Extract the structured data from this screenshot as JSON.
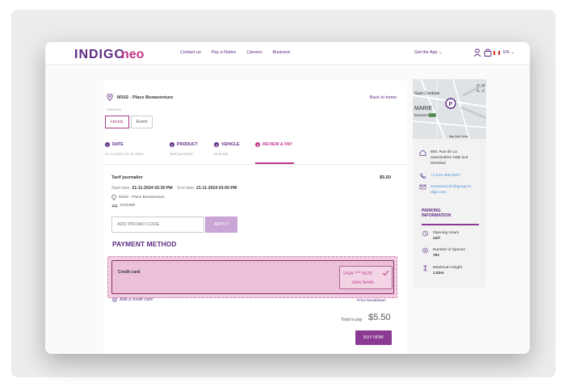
{
  "header": {
    "brand": "INDIGO neo",
    "nav": [
      "Contact us",
      "Pay a Notice",
      "Careers",
      "Business"
    ],
    "get_app": "Get the App",
    "language": "EN"
  },
  "location": {
    "name": "M102 - Place Bonaventure",
    "back_link": "Back to home",
    "parking_label": "PARKING",
    "tabs": [
      "Hourly",
      "Event"
    ],
    "active_tab": "Hourly"
  },
  "steps": [
    {
      "number": "1",
      "label": "DATE",
      "sub": "21-11-2024 21-11-2024"
    },
    {
      "number": "2",
      "label": "PRODUCT",
      "sub": "Tarif journalier"
    },
    {
      "number": "3",
      "label": "VEHICLE",
      "sub": "DCE456"
    },
    {
      "number": "4",
      "label": "REVIEW & PAY",
      "sub": ""
    }
  ],
  "summary": {
    "product": "Tarif journalier",
    "price": "$5.50",
    "start_label": "Start date:",
    "start_value": "21-11-2024 02:30 PM",
    "end_label": "End date:",
    "end_value": "21-11-2024 03:00 PM",
    "location": "M102 - Place Bonaventure",
    "plate": "DCE456"
  },
  "promo": {
    "placeholder": "ADD PROMO CODE",
    "apply_label": "APPLY"
  },
  "payment": {
    "title": "PAYMENT METHOD",
    "card_label": "Credit card",
    "card_number": "VISA **** 5678",
    "card_holder": "John Smith",
    "add_card": "Add a credit card",
    "breakdown": "Price breakdown",
    "total_label": "Total to pay",
    "total_value": "$5.50",
    "buy_label": "BUY NOW"
  },
  "sidebar": {
    "map_labels": {
      "place1": "Gare Centrale",
      "district": "MARIE",
      "place2": "Bonaventure",
      "footer": "Map Data  Terms"
    },
    "address": [
      "800, Rue de La",
      "Gauchetière H3B 4L9",
      "Montréal"
    ],
    "phone": "+1 514-405-5457",
    "email": [
      "montreal.info@group-in",
      "digo.com"
    ],
    "info_title": [
      "PARKING",
      "INFORMATION"
    ],
    "hours_label": "Opening Hours",
    "hours_value": "24/7",
    "spaces_label": "Number of Spaces",
    "spaces_value": "761",
    "height_label": "Maximum Height",
    "height_value": "1.83m"
  },
  "colors": {
    "primary": "#5c2c82",
    "accent": "#c0388a",
    "card_highlight": "#f1cde2"
  }
}
